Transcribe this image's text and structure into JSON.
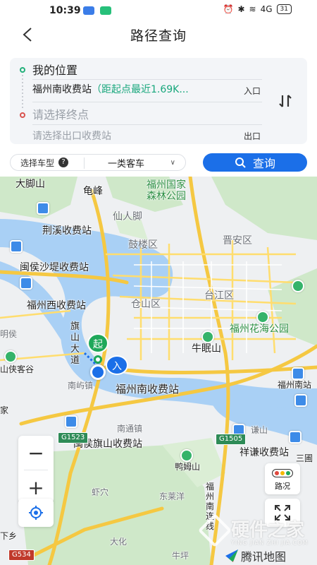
{
  "status_bar": {
    "time": "10:39",
    "signal": "4G",
    "battery": "31"
  },
  "header": {
    "title": "路径查询"
  },
  "route": {
    "start_label": "我的位置",
    "entry_station": "福州南收费站",
    "entry_hint": "（距起点最近1.69K...",
    "entry_tag": "入口",
    "end_placeholder": "请选择终点",
    "exit_placeholder": "请选择出口收费站",
    "exit_tag": "出口",
    "colors": {
      "start": "#23b07a",
      "end": "#d9534f",
      "hint": "#18a77c"
    }
  },
  "vehicle": {
    "label": "选择车型",
    "help_icon": "?",
    "selected": "一类客车",
    "arrow": "∨"
  },
  "query_button": {
    "label": "查询",
    "color": "#1b6fe8"
  },
  "map": {
    "labels": {
      "dajiaoshan": "大脚山",
      "guifeng": "龟峰",
      "senlin": "福州国家\n森林公园",
      "xianren": "仙人脚",
      "jingxi": "荆溪收费站",
      "gulou": "鼓楼区",
      "jinan": "晋安区",
      "minhou": "闽侯沙堤收费站",
      "fuzhou_west": "福州西收费站",
      "cangshan": "仓山区",
      "taijiang": "台江区",
      "huahai": "福州花海公园",
      "qishan": "旗山大道",
      "niumianshan": "牛眠山",
      "minghou_short": "明侯",
      "shangjie": "上街",
      "houkeyin": "山侠客谷",
      "nanyu": "南屿镇",
      "fuzhou_south": "福州南收费站",
      "fuzhou_south_r": "福州南站",
      "nantong": "南通镇",
      "qishan_toll": "闽侯旗山收费站",
      "yamushan": "鸭姆山",
      "qianshan": "谦山",
      "xiangqian": "祥谦收费站",
      "sanjiao": "三圃",
      "xiaxue": "虾穴",
      "dongyingyang": "东莱洋",
      "dahua": "大化",
      "niuping": "牛坪",
      "nanlian": "福州南连线",
      "jia": "家",
      "la": "乐",
      "shamu": "下乡",
      "tang": "唐"
    },
    "shields": [
      "G1523",
      "G1505",
      "G534"
    ],
    "controls": {
      "zoom_out": "−",
      "zoom_in": "+",
      "traffic_label": "路况"
    },
    "brand": "腾讯地图",
    "watermark_main": "硬件之家",
    "watermark_sub": "YING JIAN ZHI JIA.COM"
  },
  "markers": {
    "start": "起",
    "entry": "入"
  }
}
